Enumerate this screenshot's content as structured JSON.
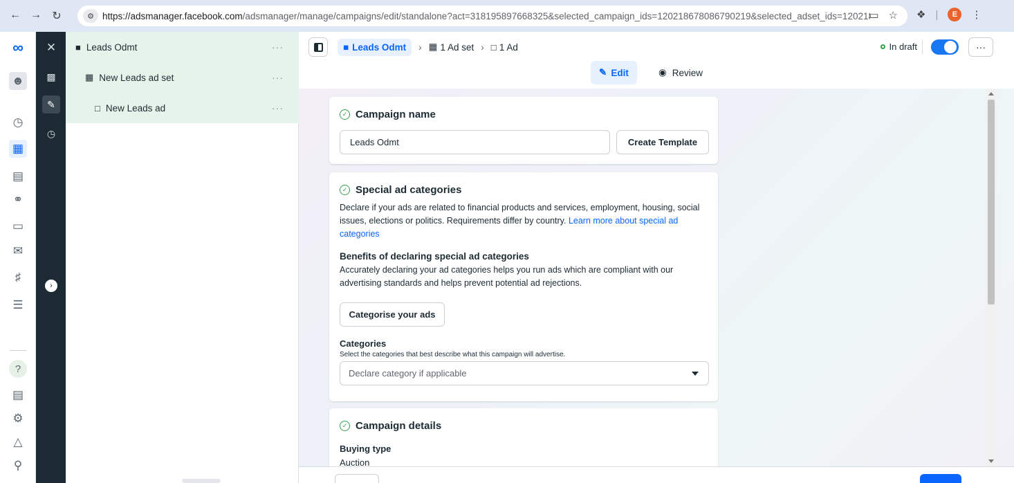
{
  "browser": {
    "url_host": "https://adsmanager.facebook.com",
    "url_path": "/adsmanager/manage/campaigns/edit/standalone?act=318195897668325&selected_campaign_ids=120218678086790219&selected_adset_ids=120218...",
    "profile_initial": "E"
  },
  "tree": {
    "items": [
      {
        "label": "Leads Odmt"
      },
      {
        "label": "New Leads ad set"
      },
      {
        "label": "New Leads ad"
      }
    ],
    "more": "···"
  },
  "toolbar": {
    "campaign": "Leads Odmt",
    "adset_crumb": "1 Ad set",
    "ad_crumb": "1 Ad",
    "status": "In draft",
    "more": "···"
  },
  "tabs": {
    "edit": "Edit",
    "review": "Review"
  },
  "campaign_name": {
    "title": "Campaign name",
    "value": "Leads Odmt",
    "template_button": "Create Template"
  },
  "special_ad": {
    "title": "Special ad categories",
    "desc": "Declare if your ads are related to financial products and services, employment, housing, social issues, elections or politics. Requirements differ by country.",
    "link": "Learn more about special ad categories",
    "benefits_title": "Benefits of declaring special ad categories",
    "benefits_desc": "Accurately declaring your ad categories helps you run ads which are compliant with our advertising standards and helps prevent potential ad rejections.",
    "categorise_button": "Categorise your ads",
    "categories_label": "Categories",
    "categories_note": "Select the categories that best describe what this campaign will advertise.",
    "categories_placeholder": "Declare category if applicable"
  },
  "campaign_details": {
    "title": "Campaign details",
    "buying_type_label": "Buying type",
    "buying_type_value": "Auction"
  },
  "colors": {
    "accent": "#0866ff",
    "dark_strip": "#1c2b33",
    "tree_highlight": "#e6f3ea",
    "draft_dot": "#31a24c"
  }
}
